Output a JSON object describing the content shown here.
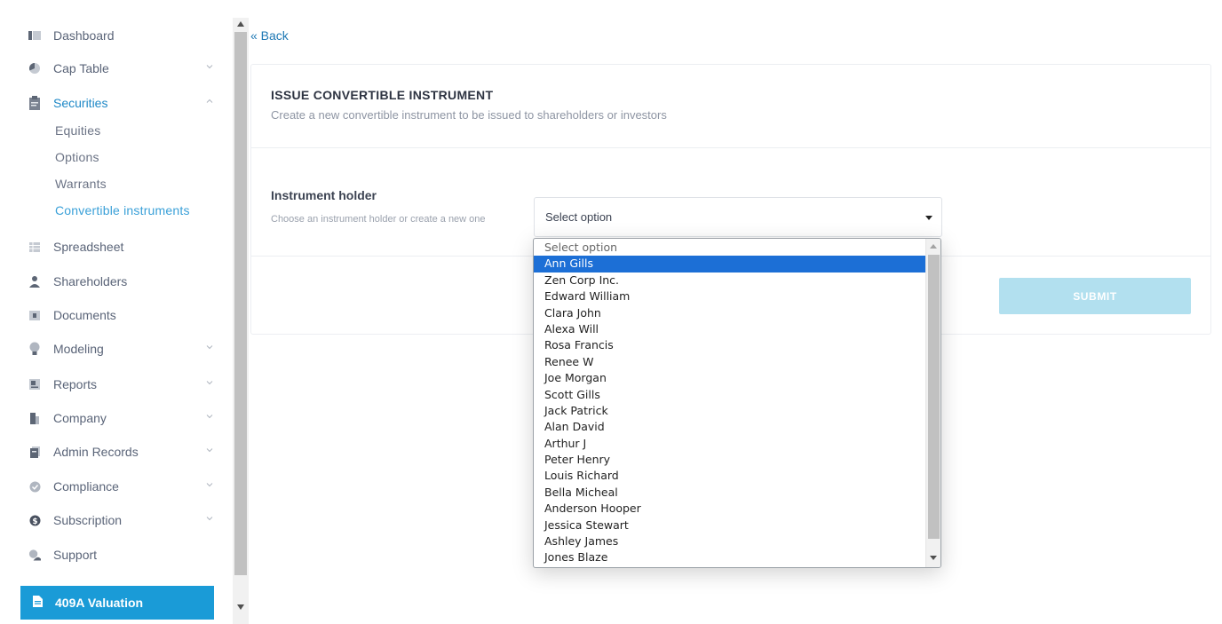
{
  "sidebar": {
    "items": [
      {
        "label": "Dashboard",
        "icon": "dashboard-icon",
        "chevron": false
      },
      {
        "label": "Cap Table",
        "icon": "pie-chart-icon",
        "chevron": true
      },
      {
        "label": "Securities",
        "icon": "clipboard-icon",
        "chevron": true,
        "expanded": true
      },
      {
        "label": "Spreadsheet",
        "icon": "spreadsheet-icon",
        "chevron": false
      },
      {
        "label": "Shareholders",
        "icon": "user-icon",
        "chevron": false
      },
      {
        "label": "Documents",
        "icon": "folder-icon",
        "chevron": false
      },
      {
        "label": "Modeling",
        "icon": "lightbulb-icon",
        "chevron": true
      },
      {
        "label": "Reports",
        "icon": "report-icon",
        "chevron": true
      },
      {
        "label": "Company",
        "icon": "building-icon",
        "chevron": true
      },
      {
        "label": "Admin Records",
        "icon": "records-icon",
        "chevron": true
      },
      {
        "label": "Compliance",
        "icon": "shield-check-icon",
        "chevron": true
      },
      {
        "label": "Subscription",
        "icon": "dollar-icon",
        "chevron": true
      },
      {
        "label": "Support",
        "icon": "support-icon",
        "chevron": false
      }
    ],
    "securities_sub": [
      "Equities",
      "Options",
      "Warrants",
      "Convertible instruments"
    ],
    "valuation_label": "409A Valuation"
  },
  "main": {
    "back_label": "« Back",
    "card_title": "ISSUE CONVERTIBLE INSTRUMENT",
    "card_subtitle": "Create a new convertible instrument to be issued to shareholders or investors",
    "field_label": "Instrument holder",
    "field_help": "Choose an instrument holder or create a new one",
    "select_value": "Select option",
    "submit_label": "SUBMIT"
  },
  "dropdown": {
    "options": [
      "Select option",
      "Ann Gills",
      "Zen Corp Inc.",
      "Edward William",
      "Clara John",
      "Alexa Will",
      "Rosa Francis",
      "Renee W",
      "Joe Morgan",
      "Scott Gills",
      "Jack Patrick",
      "Alan David",
      "Arthur J",
      "Peter Henry",
      "Louis Richard",
      "Bella Micheal",
      "Anderson Hooper",
      "Jessica Stewart",
      "Ashley James",
      "Jones Blaze"
    ],
    "highlighted": "Ann Gills"
  },
  "colors": {
    "accent": "#1e88c7",
    "valuation_bg": "#1a9bd7",
    "submit_bg": "#b2e0ef",
    "highlight": "#1c6fd6"
  }
}
